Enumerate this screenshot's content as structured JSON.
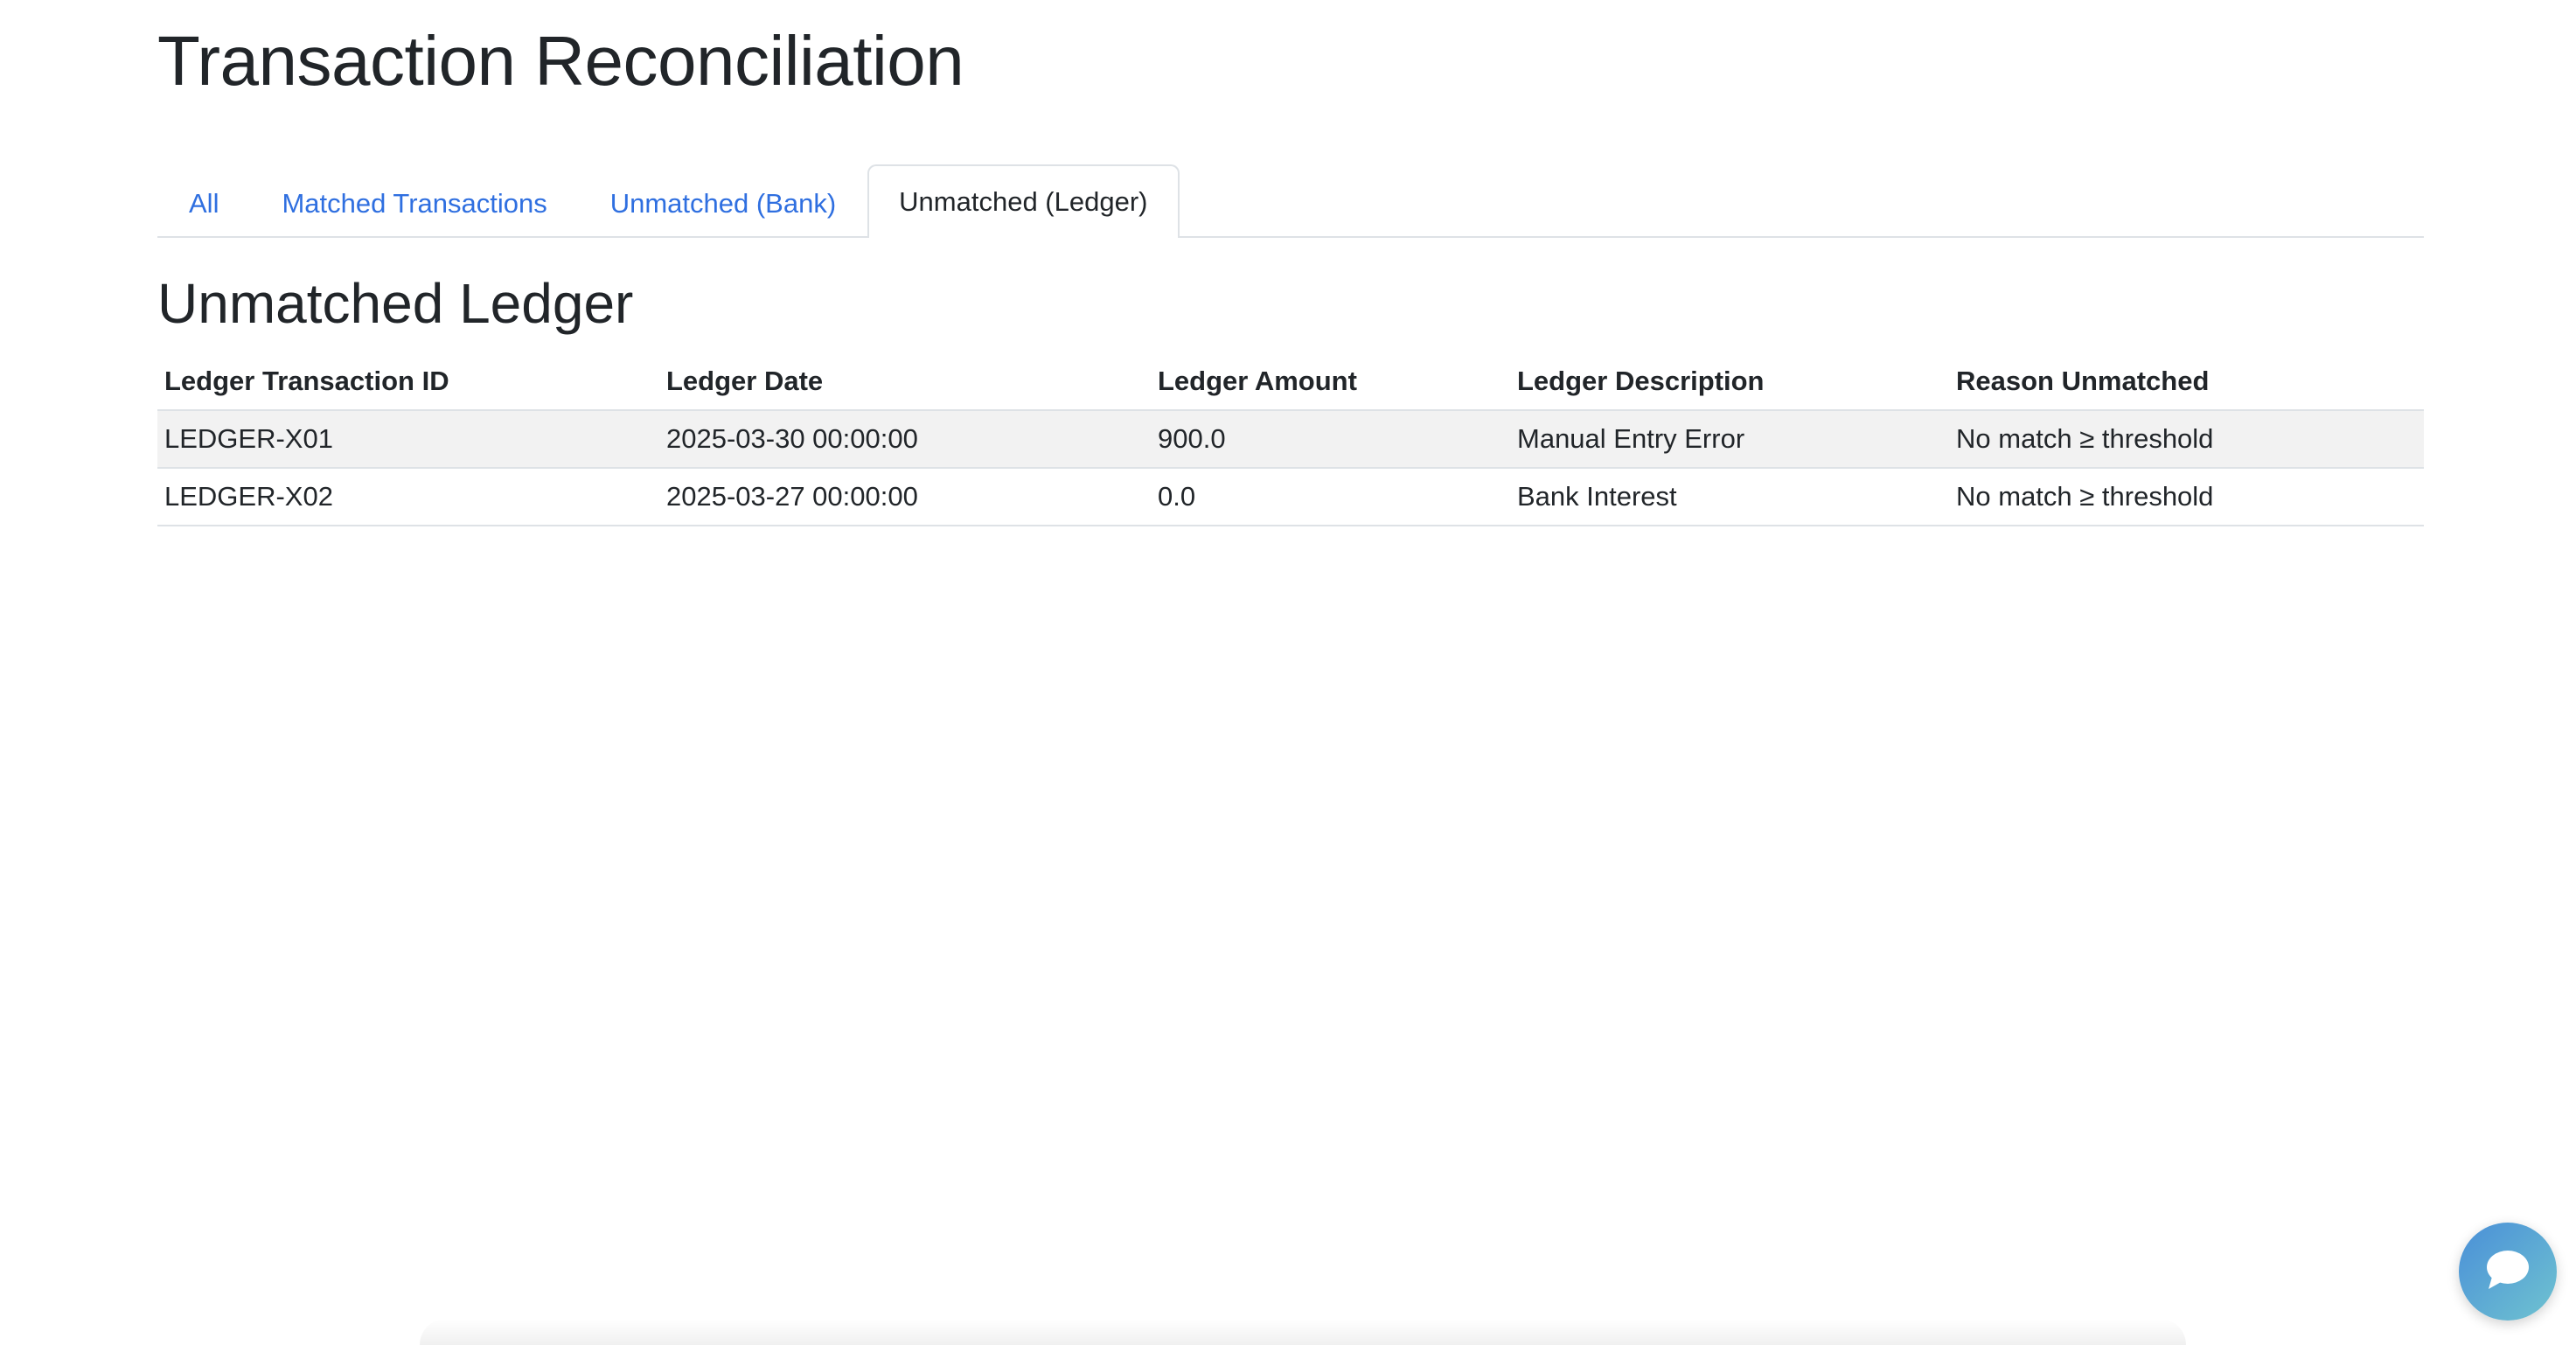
{
  "page": {
    "title": "Transaction Reconciliation"
  },
  "tabs": [
    {
      "label": "All",
      "active": false
    },
    {
      "label": "Matched Transactions",
      "active": false
    },
    {
      "label": "Unmatched (Bank)",
      "active": false
    },
    {
      "label": "Unmatched (Ledger)",
      "active": true
    }
  ],
  "section": {
    "title": "Unmatched Ledger"
  },
  "table": {
    "headers": [
      "Ledger Transaction ID",
      "Ledger Date",
      "Ledger Amount",
      "Ledger Description",
      "Reason Unmatched"
    ],
    "rows": [
      [
        "LEDGER-X01",
        "2025-03-30 00:00:00",
        "900.0",
        "Manual Entry Error",
        "No match ≥ threshold"
      ],
      [
        "LEDGER-X02",
        "2025-03-27 00:00:00",
        "0.0",
        "Bank Interest",
        "No match ≥ threshold"
      ]
    ]
  },
  "chat": {
    "icon": "chat-bubble-icon"
  },
  "colors": {
    "link": "#2f6fe0",
    "text": "#212529",
    "border": "#dee2e6",
    "stripe": "#f2f2f2",
    "chat_gradient_start": "#4a8fd8",
    "chat_gradient_end": "#6fc3d0"
  }
}
